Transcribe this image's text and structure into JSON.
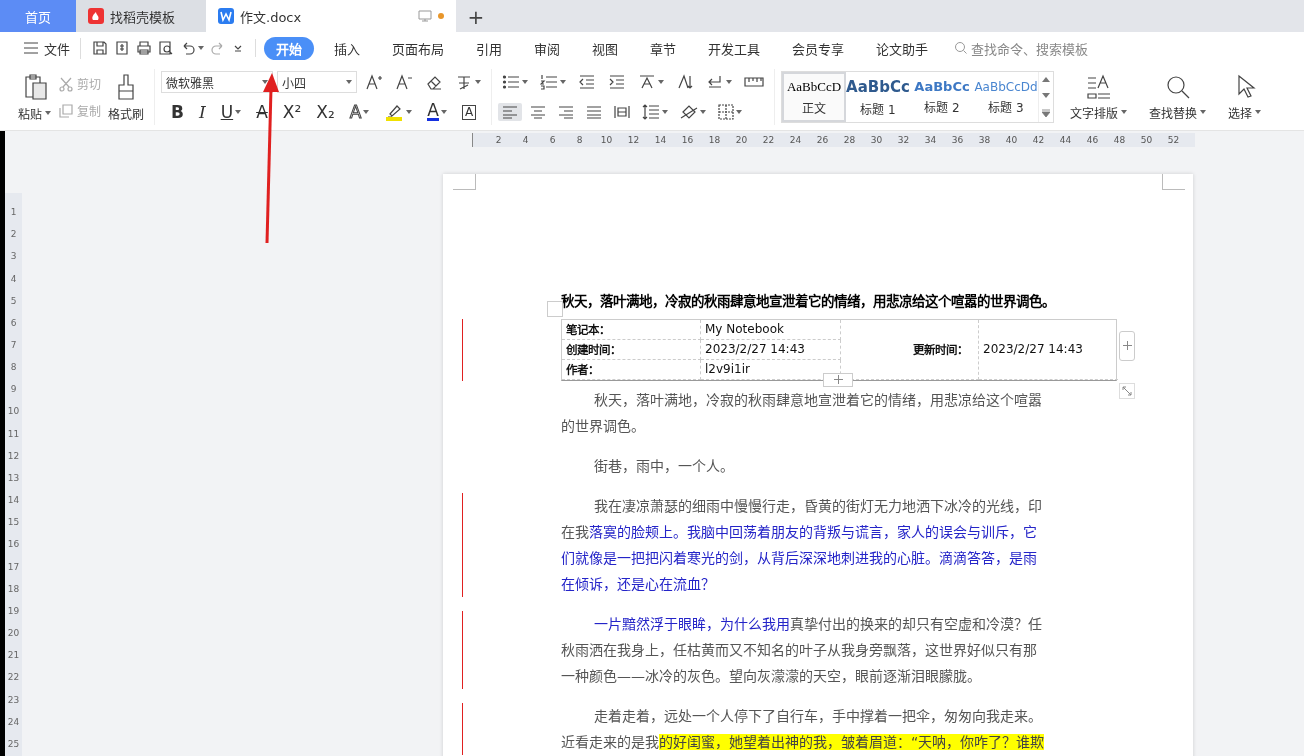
{
  "doc_tabs": [
    {
      "label": "首页",
      "kind": "home",
      "selected": false,
      "unsaved": false
    },
    {
      "label": "找稻壳模板",
      "kind": "template",
      "selected": false,
      "unsaved": false
    },
    {
      "label": "作文.docx",
      "kind": "document",
      "selected": true,
      "unsaved": true
    }
  ],
  "new_tab": "+",
  "menu": {
    "file": "文件",
    "quick": [
      {
        "kind": "save",
        "disabled": false,
        "dropdown": false
      },
      {
        "kind": "export",
        "disabled": false,
        "dropdown": false
      },
      {
        "kind": "print",
        "disabled": false,
        "dropdown": false
      },
      {
        "kind": "preview",
        "disabled": false,
        "dropdown": false
      },
      {
        "kind": "undo",
        "disabled": false,
        "dropdown": true
      },
      {
        "kind": "redo",
        "disabled": true,
        "dropdown": false
      },
      {
        "kind": "more",
        "disabled": false,
        "dropdown": false
      }
    ],
    "tabs": [
      {
        "label": "开始",
        "selected": true
      },
      {
        "label": "插入",
        "selected": false
      },
      {
        "label": "页面布局",
        "selected": false
      },
      {
        "label": "引用",
        "selected": false
      },
      {
        "label": "审阅",
        "selected": false
      },
      {
        "label": "视图",
        "selected": false
      },
      {
        "label": "章节",
        "selected": false
      },
      {
        "label": "开发工具",
        "selected": false
      },
      {
        "label": "会员专享",
        "selected": false
      },
      {
        "label": "论文助手",
        "selected": false
      }
    ],
    "search_placeholder": "查找命令、搜索模板"
  },
  "toolbar": {
    "paste": {
      "label": "粘贴",
      "kind": "clipboard",
      "dropdown": true
    },
    "small": [
      {
        "label": "剪切",
        "kind": "scissors",
        "disabled": true
      },
      {
        "label": "复制",
        "kind": "copy",
        "disabled": true
      }
    ],
    "brush": {
      "label": "格式刷",
      "kind": "brush"
    },
    "font_name": "微软雅黑",
    "font_size": "小四",
    "font_row1": [
      {
        "kind": "font-grow",
        "dropdown": false
      },
      {
        "kind": "font-shrink",
        "dropdown": false
      },
      {
        "kind": "eraser",
        "dropdown": false
      },
      {
        "kind": "pinyin",
        "dropdown": true
      }
    ],
    "font_row2": [
      {
        "kind": "bold",
        "glyph": "B",
        "dropdown": false
      },
      {
        "kind": "italic",
        "glyph": "I",
        "dropdown": false
      },
      {
        "kind": "underline",
        "glyph": "U",
        "dropdown": true
      },
      {
        "kind": "strikethrough",
        "glyph": "A",
        "dropdown": false
      },
      {
        "kind": "superscript",
        "glyph": "X²",
        "dropdown": false
      },
      {
        "kind": "subscript",
        "glyph": "X₂",
        "dropdown": false
      },
      {
        "kind": "text-effect",
        "glyph": "A",
        "dropdown": true
      },
      {
        "kind": "highlighter",
        "dropdown": true
      },
      {
        "kind": "font-color",
        "glyph": "A",
        "dropdown": true
      },
      {
        "kind": "character-border",
        "glyph": "A",
        "dropdown": false
      }
    ],
    "para_row1": [
      {
        "kind": "bullet-list",
        "dropdown": true
      },
      {
        "kind": "numbered-list",
        "dropdown": true
      },
      {
        "kind": "outdent",
        "dropdown": false
      },
      {
        "kind": "indent",
        "dropdown": false
      },
      {
        "kind": "chinese-layout",
        "dropdown": true
      },
      {
        "kind": "sort",
        "dropdown": false
      },
      {
        "kind": "return-mark",
        "dropdown": true
      },
      {
        "kind": "ruler",
        "dropdown": false
      }
    ],
    "para_row2": [
      {
        "kind": "align-left",
        "dropdown": false,
        "selected": true
      },
      {
        "kind": "align-center",
        "dropdown": false,
        "selected": false
      },
      {
        "kind": "align-right",
        "dropdown": false,
        "selected": false
      },
      {
        "kind": "justify",
        "dropdown": false,
        "selected": false
      },
      {
        "kind": "distribute",
        "dropdown": false,
        "selected": false
      },
      {
        "kind": "line-spacing",
        "dropdown": true,
        "selected": false
      },
      {
        "kind": "shading",
        "dropdown": true,
        "selected": false
      },
      {
        "kind": "borders",
        "dropdown": true,
        "selected": false
      }
    ],
    "styles": [
      {
        "preview": "AaBbCcD",
        "label": "正文",
        "kind": "body",
        "selected": true
      },
      {
        "preview": "AaBbCc",
        "label": "标题 1",
        "kind": "h1",
        "selected": false
      },
      {
        "preview": "AaBbCc",
        "label": "标题 2",
        "kind": "h2",
        "selected": false
      },
      {
        "preview": "AaBbCcDd",
        "label": "标题 3",
        "kind": "h3",
        "selected": false
      }
    ],
    "big": [
      {
        "label": "文字排版",
        "kind": "text-layout",
        "dropdown": true
      },
      {
        "label": "查找替换",
        "kind": "search",
        "dropdown": true
      },
      {
        "label": "选择",
        "kind": "pointer",
        "dropdown": true
      }
    ]
  },
  "ruler": {
    "h": [
      "2",
      "4",
      "6",
      "8",
      "10",
      "12",
      "14",
      "16",
      "18",
      "20",
      "22",
      "24",
      "26",
      "28",
      "30",
      "32",
      "34",
      "36",
      "38",
      "40",
      "42",
      "44",
      "46",
      "48",
      "50",
      "52"
    ],
    "v": [
      "1",
      "2",
      "3",
      "4",
      "5",
      "6",
      "7",
      "8",
      "9",
      "10",
      "11",
      "12",
      "13",
      "14",
      "15",
      "16",
      "17",
      "18",
      "19",
      "20",
      "21",
      "22",
      "23",
      "24",
      "25"
    ]
  },
  "document": {
    "heading": "秋天，落叶满地，冷寂的秋雨肆意地宣泄着它的情绪，用悲凉给这个喧嚣的世界调色。",
    "info_table": {
      "revised": true,
      "rows": [
        {
          "label": "笔记本：",
          "value": "My Notebook"
        },
        {
          "label": "创建时间：",
          "value": "2023/2/27 14:43"
        },
        {
          "label": "作者：",
          "value": "l2v9i1ir"
        }
      ],
      "updated_label": "更新时间：",
      "updated_value": "2023/2/27 14:43"
    },
    "paragraphs": [
      {
        "revised": false,
        "segments": [
          {
            "kind": "plain",
            "text": "秋天，落叶满地，冷寂的秋雨肆意地宣泄着它的情绪，用悲凉给这个喧嚣的世界调色。"
          }
        ]
      },
      {
        "revised": false,
        "segments": [
          {
            "kind": "plain",
            "text": "街巷，雨中，一个人。"
          }
        ]
      },
      {
        "revised": true,
        "segments": [
          {
            "kind": "plain",
            "text": "我在凄凉萧瑟的细雨中慢慢行走，昏黄的街灯无力地洒下冰冷的光线，印在我"
          },
          {
            "kind": "inserted",
            "text": "落寞的脸颊上。我脑中回荡着朋友的背叛与谎言，家人的误会与训斥，它们就像是一把把闪着寒光的剑，从背后深深地刺进我的心脏。滴滴答答，是雨在倾诉，还是心在流血？"
          }
        ]
      },
      {
        "revised": true,
        "segments": [
          {
            "kind": "inserted",
            "text": "一片黯然浮于眼眸，为什么我用"
          },
          {
            "kind": "plain",
            "text": "真挚付出的换来的却只有空虚和冷漠？任秋雨洒在我身上，任枯黄而又不知名的叶子从我身旁飘落，这世界好似只有那一种颜色——冰冷的灰色。望向灰濛濛的天空，眼前逐渐泪眼朦胧。"
          }
        ]
      },
      {
        "revised": true,
        "segments": [
          {
            "kind": "plain",
            "text": "走着走着，远处一个人停下了自行车，手中撑着一把伞，匆匆向我走来。近看走来的是我"
          },
          {
            "kind": "highlighted",
            "text": "的好闺蜜，她望着出神的我，皱着眉道：“天呐，你咋了？谁欺"
          }
        ]
      }
    ]
  }
}
